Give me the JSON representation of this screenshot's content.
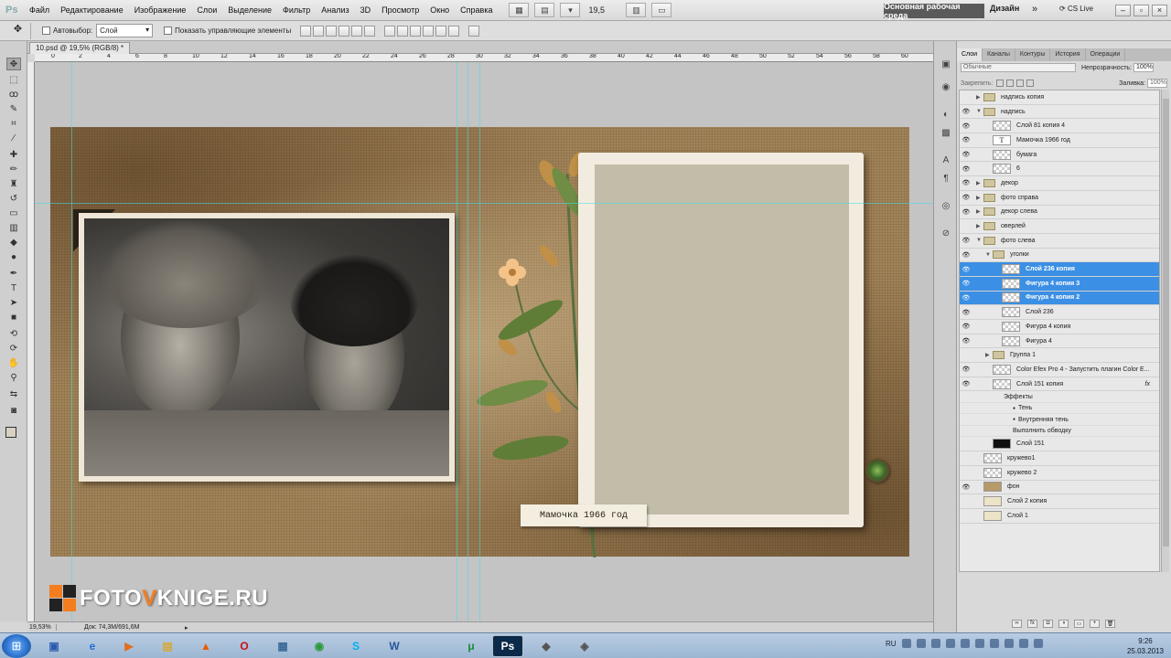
{
  "menubar": {
    "logo": "Ps",
    "items": [
      "Файл",
      "Редактирование",
      "Изображение",
      "Слои",
      "Выделение",
      "Фильтр",
      "Анализ",
      "3D",
      "Просмотр",
      "Окно",
      "Справка"
    ],
    "zoom": "19,5",
    "workspace": "Основная рабочая среда",
    "design": "Дизайн",
    "more": "»",
    "cslive": "CS Live"
  },
  "options": {
    "autoselect_label": "Автовыбор:",
    "autoselect_value": "Слой",
    "show_controls_label": "Показать управляющие элементы"
  },
  "document": {
    "tab_title": "10.psd @ 19,5% (RGB/8) *",
    "ruler_ticks": [
      "0",
      "2",
      "4",
      "6",
      "8",
      "10",
      "12",
      "14",
      "16",
      "18",
      "20",
      "22",
      "24",
      "26",
      "28",
      "30",
      "32",
      "34",
      "36",
      "38",
      "40",
      "42",
      "44",
      "46",
      "48",
      "50",
      "52",
      "54",
      "56",
      "58",
      "60"
    ],
    "caption": "Мамочка  1966 год",
    "logo_prefix": "FOTO",
    "logo_accent": "V",
    "logo_suffix": "KNIGE.RU"
  },
  "status": {
    "zoom": "19,53%",
    "doc": "Док: 74,3M/691,6M"
  },
  "layers_panel": {
    "tabs": [
      "Слои",
      "Каналы",
      "Контуры",
      "История",
      "Операции"
    ],
    "blend_mode": "Обычные",
    "opacity_label": "Непрозрачность:",
    "opacity_value": "100%",
    "lock_label": "Закрепить:",
    "fill_label": "Заливка:",
    "fill_value": "100%",
    "layers": [
      {
        "name": "надпись копия",
        "kind": "folder",
        "visible": false,
        "indent": 0,
        "expanded": false,
        "selected": false
      },
      {
        "name": "надпись",
        "kind": "folder",
        "visible": true,
        "indent": 0,
        "expanded": true,
        "selected": false
      },
      {
        "name": "Слой 81 копия 4",
        "kind": "layer",
        "visible": true,
        "indent": 1,
        "selected": false
      },
      {
        "name": "Мамочка  1966 год",
        "kind": "text",
        "visible": true,
        "indent": 1,
        "selected": false
      },
      {
        "name": "бумага",
        "kind": "layer",
        "visible": true,
        "indent": 1,
        "selected": false
      },
      {
        "name": "6",
        "kind": "layer",
        "visible": true,
        "indent": 1,
        "selected": false
      },
      {
        "name": "декор",
        "kind": "folder",
        "visible": true,
        "indent": 0,
        "expanded": false,
        "selected": false
      },
      {
        "name": "фото справа",
        "kind": "folder",
        "visible": true,
        "indent": 0,
        "expanded": false,
        "selected": false
      },
      {
        "name": "декор слева",
        "kind": "folder",
        "visible": true,
        "indent": 0,
        "expanded": false,
        "selected": false
      },
      {
        "name": "оверлей",
        "kind": "folder",
        "visible": false,
        "indent": 0,
        "expanded": false,
        "selected": false
      },
      {
        "name": "фото слева",
        "kind": "folder",
        "visible": true,
        "indent": 0,
        "expanded": true,
        "selected": false
      },
      {
        "name": "уголки",
        "kind": "folder",
        "visible": true,
        "indent": 1,
        "expanded": true,
        "selected": false
      },
      {
        "name": "Слой 236 копия",
        "kind": "layer",
        "visible": true,
        "indent": 2,
        "selected": true
      },
      {
        "name": "Фигура 4 копия 3",
        "kind": "layer",
        "visible": true,
        "indent": 2,
        "selected": true
      },
      {
        "name": "Фигура 4 копия 2",
        "kind": "layer",
        "visible": true,
        "indent": 2,
        "selected": true
      },
      {
        "name": "Слой 236",
        "kind": "layer",
        "visible": true,
        "indent": 2,
        "selected": false
      },
      {
        "name": "Фигура 4 копия",
        "kind": "layer",
        "visible": true,
        "indent": 2,
        "selected": false
      },
      {
        "name": "Фигура 4",
        "kind": "layer",
        "visible": true,
        "indent": 2,
        "selected": false
      },
      {
        "name": "Группа 1",
        "kind": "folder",
        "visible": false,
        "indent": 1,
        "expanded": false,
        "selected": false
      },
      {
        "name": "Color Efex Pro 4 - Запустить плагин Color E...",
        "kind": "layer",
        "visible": true,
        "indent": 1,
        "selected": false
      },
      {
        "name": "Слой 151 копия",
        "kind": "layer",
        "visible": true,
        "indent": 1,
        "selected": false,
        "fx": "fx"
      },
      {
        "name": "Эффекты",
        "kind": "sub",
        "indent": 2
      },
      {
        "name": "Тень",
        "kind": "sub",
        "indent": 3
      },
      {
        "name": "Внутренняя тень",
        "kind": "sub",
        "indent": 3
      },
      {
        "name": "Выполнить обводку",
        "kind": "sub",
        "indent": 3
      },
      {
        "name": "Слой 151",
        "kind": "dark",
        "visible": false,
        "indent": 1,
        "selected": false
      },
      {
        "name": "кружево1",
        "kind": "layer",
        "visible": false,
        "indent": 0,
        "selected": false
      },
      {
        "name": "кружево 2",
        "kind": "layer",
        "visible": false,
        "indent": 0,
        "selected": false
      },
      {
        "name": "фон",
        "kind": "photo",
        "visible": true,
        "indent": 0,
        "selected": false
      },
      {
        "name": "Слой 2 копия",
        "kind": "cream",
        "visible": false,
        "indent": 0,
        "selected": false
      },
      {
        "name": "Слой 1",
        "kind": "cream",
        "visible": false,
        "indent": 0,
        "selected": false
      }
    ]
  },
  "taskbar": {
    "lang": "RU",
    "time": "9:26",
    "date": "25.03.2013"
  },
  "colors": {
    "accent_selection": "#3b8fe4",
    "logo_orange": "#f47e1f",
    "guide": "#46dce6"
  }
}
